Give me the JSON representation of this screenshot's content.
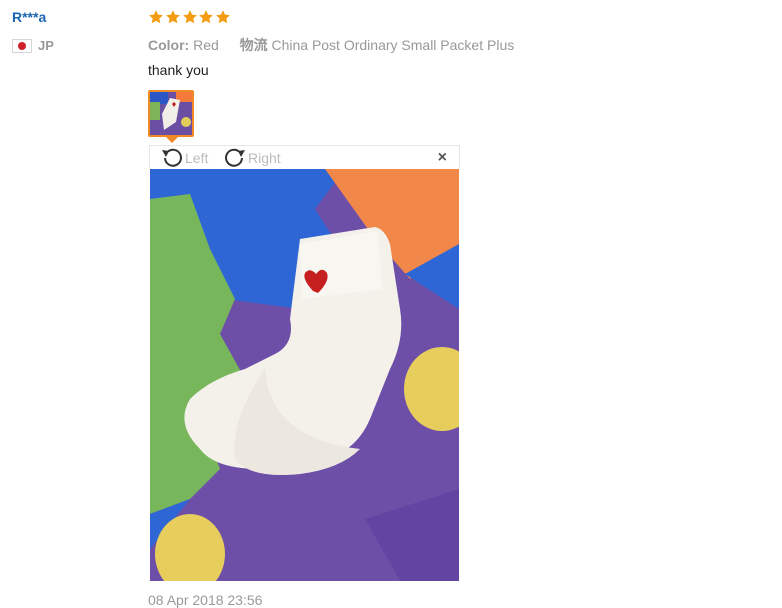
{
  "reviewer": {
    "name": "R***a",
    "country_code": "JP",
    "flag_icon": "japan-flag-icon"
  },
  "rating": {
    "stars": 5,
    "max": 5,
    "color": "#f39c12"
  },
  "attributes": {
    "color_label": "Color:",
    "color_value": "Red",
    "shipping_label": "物流",
    "shipping_value": "China Post Ordinary Small Packet Plus"
  },
  "feedback_text": "thank you",
  "image_viewer": {
    "rotate_left_label": "Left",
    "rotate_right_label": "Right",
    "close_symbol": "×"
  },
  "review_date": "08 Apr 2018 23:56",
  "colors": {
    "name_blue": "#1a66b3",
    "accent_orange": "#f08a24",
    "muted": "#999999"
  }
}
